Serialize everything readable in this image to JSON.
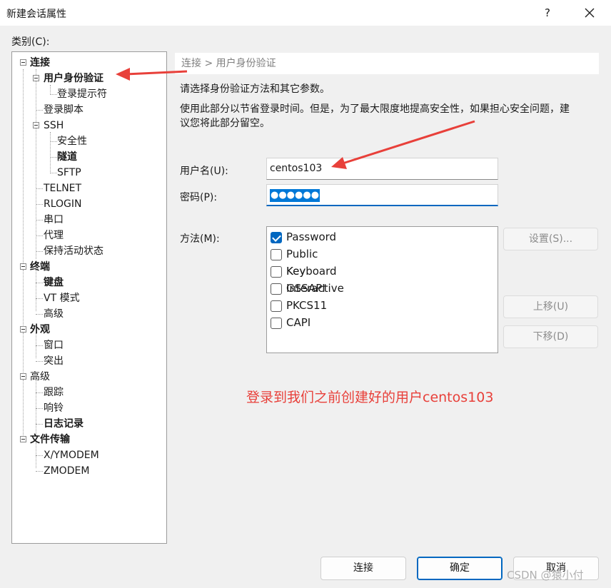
{
  "window": {
    "title": "新建会话属性",
    "help_label": "?"
  },
  "category_label": "类别(C):",
  "tree": {
    "connect": "连接",
    "auth": "用户身份验证",
    "login_prompt": "登录提示符",
    "login_script": "登录脚本",
    "ssh": "SSH",
    "security": "安全性",
    "tunnel": "隧道",
    "sftp": "SFTP",
    "telnet": "TELNET",
    "rlogin": "RLOGIN",
    "serial": "串口",
    "proxy": "代理",
    "keepalive": "保持活动状态",
    "terminal": "终端",
    "keyboard": "键盘",
    "vt_mode": "VT 模式",
    "advanced_term": "高级",
    "appearance": "外观",
    "window_item": "窗口",
    "highlight": "突出",
    "advanced": "高级",
    "trace": "跟踪",
    "bell": "响铃",
    "log": "日志记录",
    "file_transfer": "文件传输",
    "xymodem": "X/YMODEM",
    "zmodem": "ZMODEM"
  },
  "panel": {
    "breadcrumb": "连接 > 用户身份验证",
    "desc1": "请选择身份验证方法和其它参数。",
    "desc2_line1": "使用此部分以节省登录时间。但是，为了最大限度地提高安全性，如果担心安全问题，建",
    "desc2_line2": "议您将此部分留空。",
    "username_label": "用户名(U):",
    "username_value": "centos103",
    "password_label": "密码(P):",
    "password_value": "●●●●●●",
    "method_label": "方法(M):",
    "methods": [
      {
        "label": "Password",
        "checked": true
      },
      {
        "label": "Public Key",
        "checked": false
      },
      {
        "label": "Keyboard Interactive",
        "checked": false
      },
      {
        "label": "GSSAPI",
        "checked": false
      },
      {
        "label": "PKCS11",
        "checked": false
      },
      {
        "label": "CAPI",
        "checked": false
      }
    ],
    "settings_button": "设置(S)...",
    "move_up_button": "上移(U)",
    "move_down_button": "下移(D)"
  },
  "annotation": "登录到我们之前创建好的用户centos103",
  "footer": {
    "connect_button": "连接",
    "ok_button": "确定",
    "cancel_button": "取消"
  },
  "watermark": "CSDN @猿小付",
  "colors": {
    "accent": "#0067c0",
    "annotation": "#e8403a",
    "selection": "#0078d7"
  }
}
